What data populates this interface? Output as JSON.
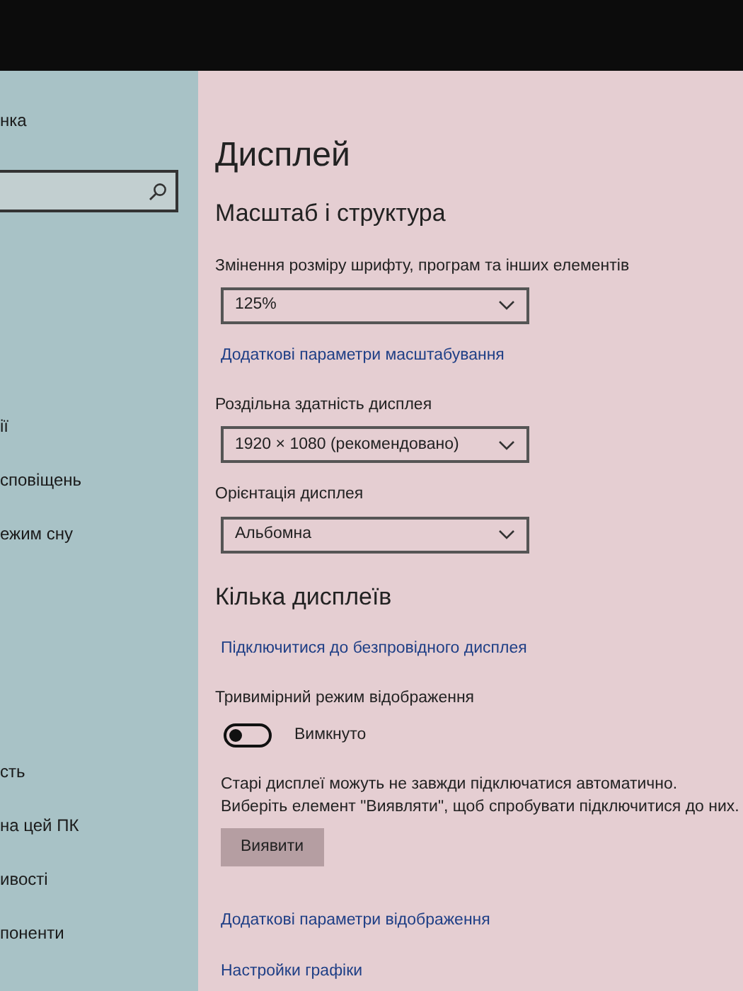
{
  "sidebar": {
    "heading": "нка",
    "items": [
      "ії",
      "сповіщень",
      "ежим сну",
      "сть",
      "на цей ПК",
      "ивості",
      "поненти"
    ]
  },
  "page": {
    "title": "Дисплей",
    "sections": [
      {
        "heading": "Масштаб і структура",
        "controls": [
          {
            "kind": "dropdown",
            "label": "Змінення розміру шрифту, програм та інших елементів",
            "value": "125%"
          },
          {
            "kind": "link",
            "text": "Додаткові параметри масштабування"
          },
          {
            "kind": "dropdown",
            "label": "Роздільна здатність дисплея",
            "value": "1920 × 1080 (рекомендовано)"
          },
          {
            "kind": "dropdown",
            "label": "Орієнтація дисплея",
            "value": "Альбомна"
          }
        ]
      },
      {
        "heading": "Кілька дисплеїв",
        "controls": [
          {
            "kind": "link",
            "text": "Підключитися до безпровідного дисплея"
          },
          {
            "kind": "toggle",
            "label": "Тривимірний режим відображення",
            "on": false,
            "state_text": "Вимкнуто"
          },
          {
            "kind": "text",
            "text": "Старі дисплеї можуть не завжди підключатися автоматично. Виберіть елемент \"Виявляти\", щоб спробувати підключитися до них."
          },
          {
            "kind": "button",
            "text": "Виявити"
          },
          {
            "kind": "link",
            "text": "Додаткові параметри відображення"
          },
          {
            "kind": "link",
            "text": "Настройки графіки"
          }
        ]
      }
    ]
  }
}
